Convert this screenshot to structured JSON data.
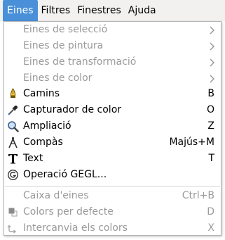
{
  "menubar": {
    "items": [
      {
        "label": "Eines"
      },
      {
        "label": "Filtres"
      },
      {
        "label": "Finestres"
      },
      {
        "label": "Ajuda"
      }
    ]
  },
  "menu": {
    "submenus": [
      {
        "label": "Eines de selecció"
      },
      {
        "label": "Eines de pintura"
      },
      {
        "label": "Eines de transformació"
      },
      {
        "label": "Eines de color"
      }
    ],
    "tools": [
      {
        "label": "Camins",
        "shortcut": "B",
        "icon": "paths-pen-icon"
      },
      {
        "label": "Capturador de color",
        "shortcut": "O",
        "icon": "color-picker-icon"
      },
      {
        "label": "Ampliació",
        "shortcut": "Z",
        "icon": "magnify-icon"
      },
      {
        "label": "Compàs",
        "shortcut": "Majús+M",
        "icon": "measure-compass-icon"
      },
      {
        "label": "Text",
        "shortcut": "T",
        "icon": "text-tool-icon"
      },
      {
        "label": "Operació GEGL...",
        "icon": "gegl-icon"
      }
    ],
    "extras": [
      {
        "label": "Caixa d'eines",
        "shortcut": "Ctrl+B"
      },
      {
        "label": "Colors per defecte",
        "shortcut": "D",
        "icon": "default-colors-icon"
      },
      {
        "label": "Intercanvia els colors",
        "shortcut": "X",
        "icon": "swap-colors-icon"
      }
    ]
  },
  "colors": {
    "accent": "#4a90d9",
    "disabled_text": "#9a9a9a",
    "menubar_bg": "#f2f1f0"
  }
}
